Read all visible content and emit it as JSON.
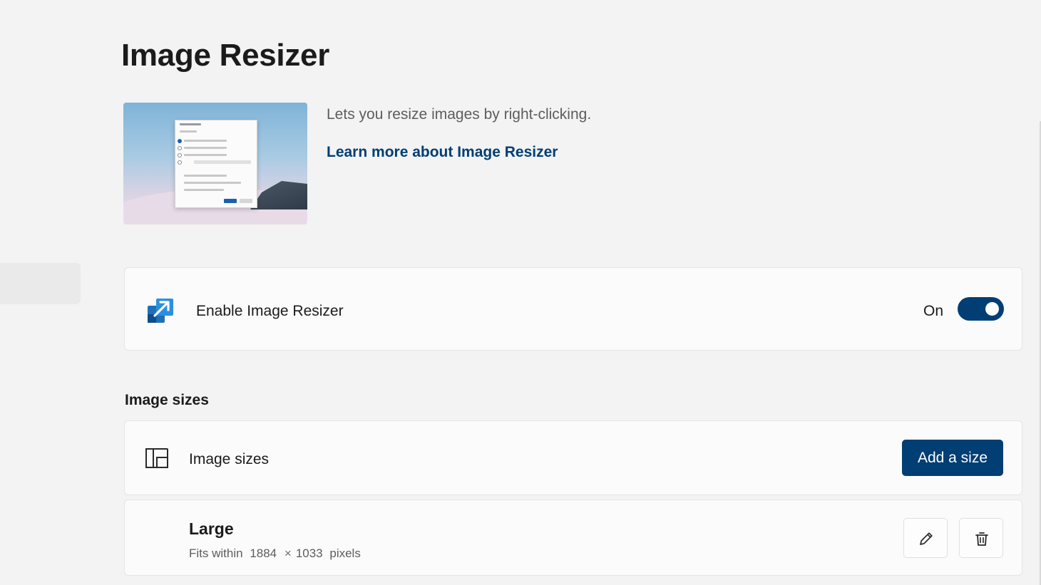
{
  "page": {
    "title": "Image Resizer"
  },
  "hero": {
    "description": "Lets you resize images by right-clicking.",
    "link_label": "Learn more about Image Resizer",
    "image_icon": "image-resizer-preview-image"
  },
  "enable_card": {
    "icon": "image-resizer-app-icon",
    "label": "Enable Image Resizer",
    "toggle_state_label": "On",
    "toggle_on": true
  },
  "image_sizes_section": {
    "header": "Image sizes",
    "card_icon": "image-sizes-icon",
    "card_label": "Image sizes",
    "add_button_label": "Add a size"
  },
  "sizes": [
    {
      "name": "Large",
      "fit_prefix": "Fits within",
      "width": "1884",
      "times_symbol": "×",
      "height": "1033",
      "unit": "pixels",
      "edit_icon": "pencil-icon",
      "delete_icon": "trash-icon"
    }
  ],
  "colors": {
    "accent": "#003e73",
    "background": "#f3f3f3",
    "card": "#fbfbfb"
  }
}
